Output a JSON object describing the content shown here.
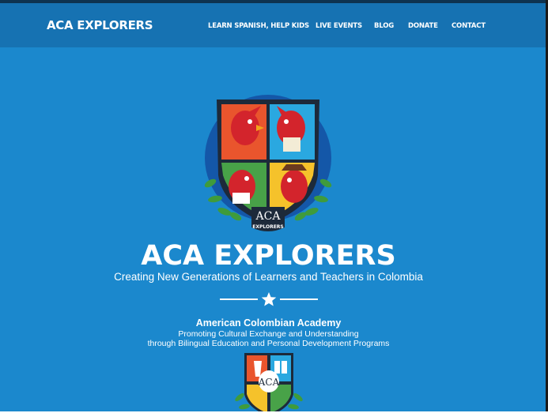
{
  "nav": {
    "brand": "ACA EXPLORERS",
    "links": [
      {
        "label": "LEARN SPANISH, HELP KIDS"
      },
      {
        "label": "LIVE EVENTS"
      },
      {
        "label": "BLOG"
      },
      {
        "label": "DONATE"
      },
      {
        "label": "CONTACT"
      }
    ]
  },
  "hero": {
    "logo_text_top": "ACA",
    "logo_text_bottom": "EXPLORERS",
    "title": "ACA EXPLORERS",
    "subtitle": "Creating New Generations of Learners and Teachers in Colombia"
  },
  "org": {
    "name": "American Colombian Academy",
    "line1": "Promoting Cultural Exchange and Understanding",
    "line2": "through Bilingual Education and Personal Development Programs",
    "emblem_text": "ACA"
  },
  "colors": {
    "background": "#1b88cd",
    "navbar": "#1672b2",
    "shield_orange": "#e9552d",
    "shield_blue": "#2aa8e0",
    "shield_green": "#48a248",
    "shield_yellow": "#f5c22b",
    "bird_red": "#d3242c"
  },
  "icons": [
    "aca-crest-logo",
    "star-icon",
    "aca-emblem-logo"
  ]
}
